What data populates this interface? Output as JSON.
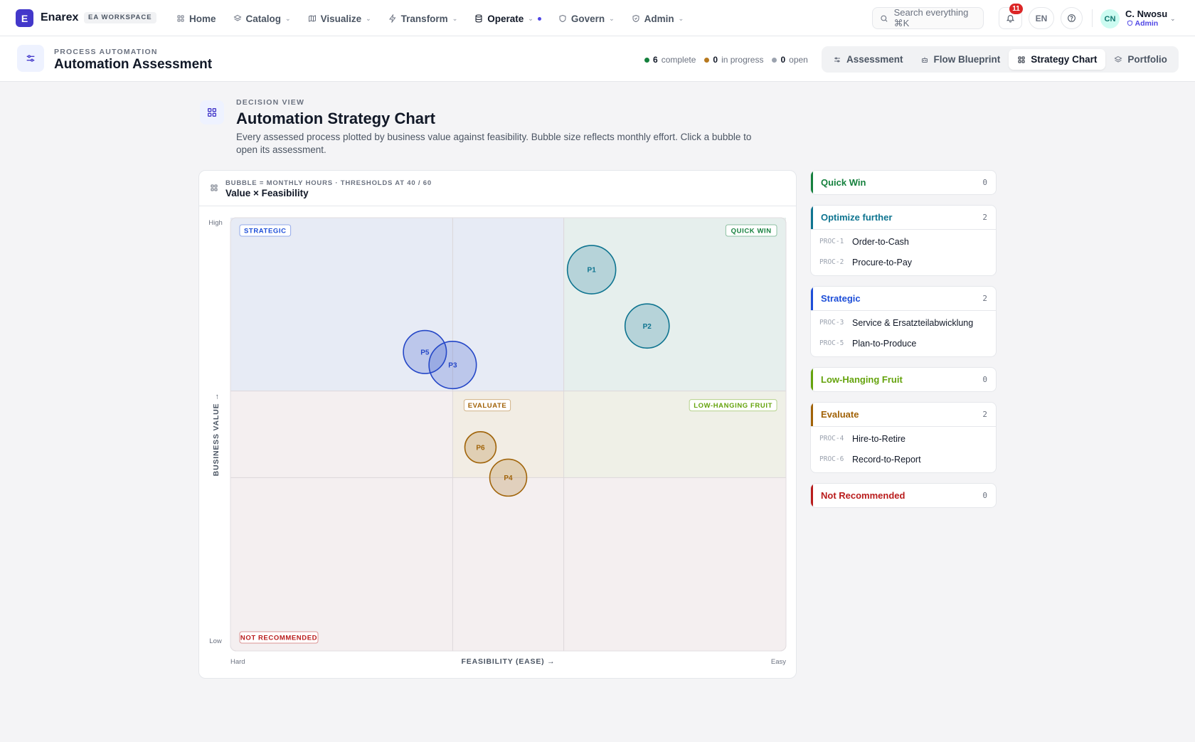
{
  "nav": {
    "logo_letter": "E",
    "brand": "Enarex",
    "workspace_badge": "EA WORKSPACE",
    "items": [
      {
        "label": "Home",
        "icon": "grid-icon",
        "dropdown": false,
        "active": false
      },
      {
        "label": "Catalog",
        "icon": "layers-icon",
        "dropdown": true,
        "active": false
      },
      {
        "label": "Visualize",
        "icon": "map-icon",
        "dropdown": true,
        "active": false
      },
      {
        "label": "Transform",
        "icon": "bolt-icon",
        "dropdown": true,
        "active": false
      },
      {
        "label": "Operate",
        "icon": "database-icon",
        "dropdown": true,
        "active": true
      },
      {
        "label": "Govern",
        "icon": "shield-icon",
        "dropdown": true,
        "active": false
      },
      {
        "label": "Admin",
        "icon": "shield-check-icon",
        "dropdown": true,
        "active": false
      }
    ],
    "search_placeholder": "Search everything ⌘K",
    "notifications_count": "11",
    "language": "EN",
    "user": {
      "initials": "CN",
      "name": "C. Nwosu",
      "role": "Admin"
    }
  },
  "subheader": {
    "kicker": "PROCESS AUTOMATION",
    "title": "Automation Assessment",
    "stats": [
      {
        "count": "6",
        "label": "complete",
        "color": "#15803d"
      },
      {
        "count": "0",
        "label": "in progress",
        "color": "#b7791f"
      },
      {
        "count": "0",
        "label": "open",
        "color": "#9ca3af"
      }
    ],
    "tabs": [
      {
        "label": "Assessment",
        "icon": "sliders-icon",
        "active": false
      },
      {
        "label": "Flow Blueprint",
        "icon": "robot-icon",
        "active": false
      },
      {
        "label": "Strategy Chart",
        "icon": "grid-icon",
        "active": true
      },
      {
        "label": "Portfolio",
        "icon": "layers-icon",
        "active": false
      }
    ]
  },
  "page": {
    "kicker": "DECISION VIEW",
    "title": "Automation Strategy Chart",
    "description": "Every assessed process plotted by business value against feasibility. Bubble size reflects monthly effort. Click a bubble to open its assessment."
  },
  "chart_card": {
    "kicker": "BUBBLE = MONTHLY HOURS · THRESHOLDS AT 40 / 60",
    "title": "Value × Feasibility"
  },
  "chart_data": {
    "type": "scatter",
    "xlabel": "FEASIBILITY (EASE) →",
    "ylabel": "BUSINESS VALUE →",
    "x_tick_labels": [
      "Hard",
      "Easy"
    ],
    "y_tick_labels": [
      "Low",
      "High"
    ],
    "xlim": [
      0,
      100
    ],
    "ylim": [
      0,
      100
    ],
    "thresholds": [
      40,
      60
    ],
    "quadrant_labels": {
      "strategic": "STRATEGIC",
      "quick_win": "QUICK WIN",
      "evaluate": "EVALUATE",
      "low_hanging_fruit": "LOW-HANGING FRUIT",
      "not_recommended": "NOT RECOMMENDED"
    },
    "points": [
      {
        "label": "P1",
        "x": 65,
        "y": 88,
        "monthly_hours": 120,
        "category": "Optimize further",
        "color": "#0e7490"
      },
      {
        "label": "P2",
        "x": 75,
        "y": 75,
        "monthly_hours": 100,
        "category": "Optimize further",
        "color": "#0e7490"
      },
      {
        "label": "P3",
        "x": 40,
        "y": 66,
        "monthly_hours": 115,
        "category": "Strategic",
        "color": "#2547c7"
      },
      {
        "label": "P5",
        "x": 35,
        "y": 69,
        "monthly_hours": 95,
        "category": "Strategic",
        "color": "#2547c7"
      },
      {
        "label": "P6",
        "x": 45,
        "y": 47,
        "monthly_hours": 50,
        "category": "Evaluate",
        "color": "#a1650b"
      },
      {
        "label": "P4",
        "x": 50,
        "y": 40,
        "monthly_hours": 70,
        "category": "Evaluate",
        "color": "#a1650b"
      }
    ]
  },
  "groups": [
    {
      "title": "Quick Win",
      "count": "0",
      "color": "#15803d",
      "items": []
    },
    {
      "title": "Optimize further",
      "count": "2",
      "color": "#0e7490",
      "items": [
        {
          "id": "PROC-1",
          "name": "Order-to-Cash"
        },
        {
          "id": "PROC-2",
          "name": "Procure-to-Pay"
        }
      ]
    },
    {
      "title": "Strategic",
      "count": "2",
      "color": "#1d4ed8",
      "items": [
        {
          "id": "PROC-3",
          "name": "Service & Ersatzteilabwicklung"
        },
        {
          "id": "PROC-5",
          "name": "Plan-to-Produce"
        }
      ]
    },
    {
      "title": "Low-Hanging Fruit",
      "count": "0",
      "color": "#65a30d",
      "items": []
    },
    {
      "title": "Evaluate",
      "count": "2",
      "color": "#a16207",
      "items": [
        {
          "id": "PROC-4",
          "name": "Hire-to-Retire"
        },
        {
          "id": "PROC-6",
          "name": "Record-to-Report"
        }
      ]
    },
    {
      "title": "Not Recommended",
      "count": "0",
      "color": "#b91c1c",
      "items": []
    }
  ]
}
